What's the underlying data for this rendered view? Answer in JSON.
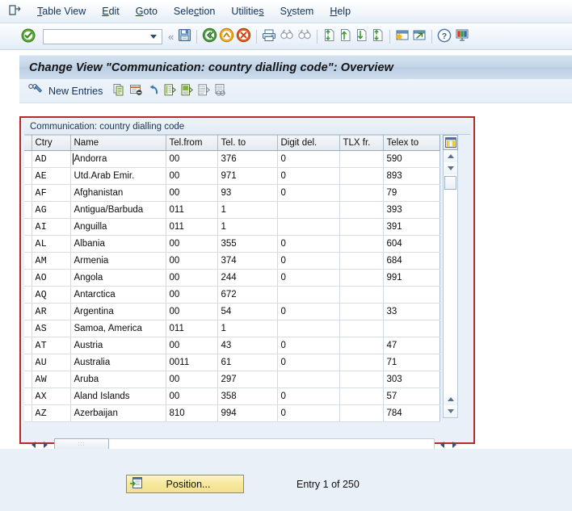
{
  "menubar": {
    "left_icon": "table-view-icon",
    "items": [
      {
        "label": "Table View",
        "accel": "T"
      },
      {
        "label": "Edit",
        "accel": "E"
      },
      {
        "label": "Goto",
        "accel": "G"
      },
      {
        "label": "Selection",
        "accel": "c"
      },
      {
        "label": "Utilities",
        "accel": "s"
      },
      {
        "label": "System",
        "accel": "y"
      },
      {
        "label": "Help",
        "accel": "H"
      }
    ]
  },
  "toolbar": {
    "enter_icon": "green-check-enter-icon",
    "command_field_value": "",
    "command_field_placeholder": "",
    "dropdown_icon": "chevron-down-icon",
    "collapse_icon": "double-chevron-left-icon",
    "icons": [
      "save-icon",
      "back-icon",
      "exit-icon",
      "cancel-icon",
      "print-icon",
      "find-icon",
      "find-next-icon",
      "first-page-icon",
      "previous-page-icon",
      "next-page-icon",
      "last-page-icon",
      "create-session-icon",
      "create-shortcut-icon",
      "help-icon",
      "customize-layout-icon"
    ]
  },
  "title": {
    "text": "Change View \"Communication: country dialling code\": Overview"
  },
  "apptoolbar": {
    "display_change_icon": "display-change-icon",
    "new_entries_label": "New Entries",
    "icons": [
      "copy-as-icon",
      "delete-icon",
      "undo-icon",
      "select-all-icon",
      "select-block-icon",
      "deselect-all-icon",
      "details-icon"
    ]
  },
  "grid": {
    "caption": "Communication: country dialling code",
    "column_config_icon": "column-config-icon",
    "columns": [
      "Ctry",
      "Name",
      "Tel.from",
      "Tel. to",
      "Digit del.",
      "TLX fr.",
      "Telex to"
    ],
    "rows": [
      {
        "ctry": "AD",
        "name": "Andorra",
        "tel_from": "00",
        "tel_to": "376",
        "digit_del": "0",
        "tlx_fr": "",
        "telex_to": "590"
      },
      {
        "ctry": "AE",
        "name": "Utd.Arab Emir.",
        "tel_from": "00",
        "tel_to": "971",
        "digit_del": "0",
        "tlx_fr": "",
        "telex_to": "893"
      },
      {
        "ctry": "AF",
        "name": "Afghanistan",
        "tel_from": "00",
        "tel_to": "93",
        "digit_del": "0",
        "tlx_fr": "",
        "telex_to": "79"
      },
      {
        "ctry": "AG",
        "name": "Antigua/Barbuda",
        "tel_from": "011",
        "tel_to": "1",
        "digit_del": "",
        "tlx_fr": "",
        "telex_to": "393"
      },
      {
        "ctry": "AI",
        "name": "Anguilla",
        "tel_from": "011",
        "tel_to": "1",
        "digit_del": "",
        "tlx_fr": "",
        "telex_to": "391"
      },
      {
        "ctry": "AL",
        "name": "Albania",
        "tel_from": "00",
        "tel_to": "355",
        "digit_del": "0",
        "tlx_fr": "",
        "telex_to": "604"
      },
      {
        "ctry": "AM",
        "name": "Armenia",
        "tel_from": "00",
        "tel_to": "374",
        "digit_del": "0",
        "tlx_fr": "",
        "telex_to": "684"
      },
      {
        "ctry": "AO",
        "name": "Angola",
        "tel_from": "00",
        "tel_to": "244",
        "digit_del": "0",
        "tlx_fr": "",
        "telex_to": "991"
      },
      {
        "ctry": "AQ",
        "name": "Antarctica",
        "tel_from": "00",
        "tel_to": "672",
        "digit_del": "",
        "tlx_fr": "",
        "telex_to": ""
      },
      {
        "ctry": "AR",
        "name": "Argentina",
        "tel_from": "00",
        "tel_to": "54",
        "digit_del": "0",
        "tlx_fr": "",
        "telex_to": "33"
      },
      {
        "ctry": "AS",
        "name": "Samoa, America",
        "tel_from": "011",
        "tel_to": "1",
        "digit_del": "",
        "tlx_fr": "",
        "telex_to": ""
      },
      {
        "ctry": "AT",
        "name": "Austria",
        "tel_from": "00",
        "tel_to": "43",
        "digit_del": "0",
        "tlx_fr": "",
        "telex_to": "47"
      },
      {
        "ctry": "AU",
        "name": "Australia",
        "tel_from": "0011",
        "tel_to": "61",
        "digit_del": "0",
        "tlx_fr": "",
        "telex_to": "71"
      },
      {
        "ctry": "AW",
        "name": "Aruba",
        "tel_from": "00",
        "tel_to": "297",
        "digit_del": "",
        "tlx_fr": "",
        "telex_to": "303"
      },
      {
        "ctry": "AX",
        "name": "Aland Islands",
        "tel_from": "00",
        "tel_to": "358",
        "digit_del": "0",
        "tlx_fr": "",
        "telex_to": "57"
      },
      {
        "ctry": "AZ",
        "name": "Azerbaijan",
        "tel_from": "810",
        "tel_to": "994",
        "digit_del": "0",
        "tlx_fr": "",
        "telex_to": "784"
      }
    ]
  },
  "footer": {
    "position_button_label": "Position...",
    "position_button_icon": "position-icon",
    "entry_status": "Entry 1 of 250"
  },
  "colors": {
    "accent_border": "#b52a2a",
    "title_bar": "#c3d5e8",
    "page_background": "#eaf0f7",
    "button_yellow": "#f7e89c",
    "row_key_fill": "#dfe9f3"
  }
}
